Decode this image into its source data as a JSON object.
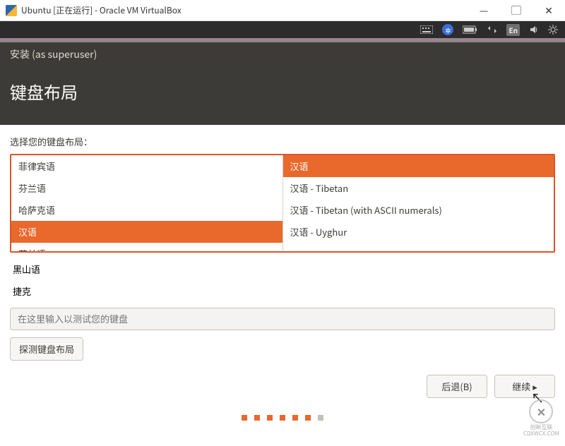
{
  "window": {
    "title": "Ubuntu [正在运行] - Oracle VM VirtualBox"
  },
  "menubar": {
    "en_label": "En"
  },
  "installer": {
    "titlebar": "安装 (as superuser)",
    "heading": "键盘布局",
    "prompt": "选择您的键盘布局：",
    "left_list_visible": [
      "菲律宾语",
      "芬兰语",
      "哈萨克语",
      "汉语",
      "荷兰语"
    ],
    "left_list_overflow": [
      "黑山语",
      "捷克"
    ],
    "left_selected_index": 3,
    "right_list": [
      "汉语",
      "汉语 - Tibetan",
      "汉语 - Tibetan (with ASCII numerals)",
      "汉语 - Uyghur"
    ],
    "right_selected_index": 0,
    "test_placeholder": "在这里输入以测试您的键盘",
    "detect_button": "探测键盘布局",
    "back_button": "后退(B)",
    "continue_button": "继续",
    "dots_total": 7,
    "dots_active_until": 6
  },
  "watermark": {
    "brand": "创新互联",
    "sub": "CDXWCX.COM"
  }
}
